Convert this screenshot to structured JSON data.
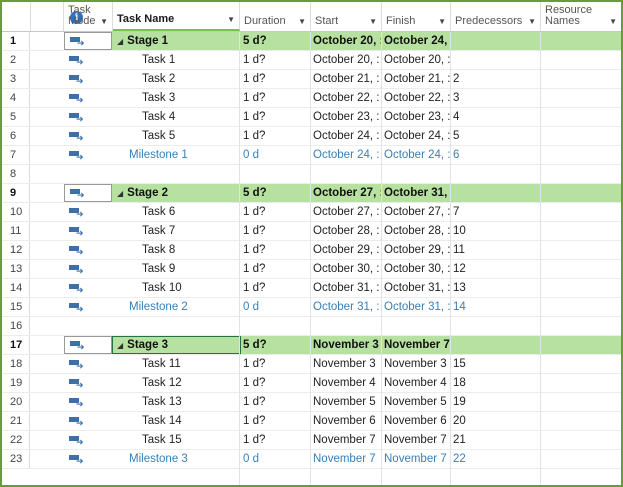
{
  "columns": {
    "mode": "Task\nMode",
    "task_name": "Task Name",
    "duration": "Duration",
    "start": "Start",
    "finish": "Finish",
    "predecessors": "Predecessors",
    "resource_names": "Resource\nNames"
  },
  "rows": [
    {
      "id": "1",
      "type": "summary",
      "name": "Stage 1",
      "duration": "5 d?",
      "start": "October 20, :",
      "finish": "October 24, :",
      "pred": "",
      "note": false
    },
    {
      "id": "2",
      "type": "task",
      "name": "Task 1",
      "duration": "1 d?",
      "start": "October 20, :",
      "finish": "October 20, :",
      "pred": "",
      "note": true
    },
    {
      "id": "3",
      "type": "task",
      "name": "Task 2",
      "duration": "1 d?",
      "start": "October 21, :",
      "finish": "October 21, :",
      "pred": "2",
      "note": true
    },
    {
      "id": "4",
      "type": "task",
      "name": "Task 3",
      "duration": "1 d?",
      "start": "October 22, :",
      "finish": "October 22, :",
      "pred": "3",
      "note": true
    },
    {
      "id": "5",
      "type": "task",
      "name": "Task 4",
      "duration": "1 d?",
      "start": "October 23, :",
      "finish": "October 23, :",
      "pred": "4",
      "note": true
    },
    {
      "id": "6",
      "type": "task",
      "name": "Task 5",
      "duration": "1 d?",
      "start": "October 24, :",
      "finish": "October 24, :",
      "pred": "5",
      "note": false
    },
    {
      "id": "7",
      "type": "milestone",
      "name": "Milestone 1",
      "duration": "0 d",
      "start": "October 24, :",
      "finish": "October 24, :",
      "pred": "6",
      "note": false
    },
    {
      "id": "8",
      "type": "blank"
    },
    {
      "id": "9",
      "type": "summary",
      "name": "Stage 2",
      "duration": "5 d?",
      "start": "October 27, :",
      "finish": "October 31, :",
      "pred": "",
      "note": false
    },
    {
      "id": "10",
      "type": "task",
      "name": "Task 6",
      "duration": "1 d?",
      "start": "October 27, :",
      "finish": "October 27, :",
      "pred": "7",
      "note": false
    },
    {
      "id": "11",
      "type": "task",
      "name": "Task 7",
      "duration": "1 d?",
      "start": "October 28, :",
      "finish": "October 28, :",
      "pred": "10",
      "note": false
    },
    {
      "id": "12",
      "type": "task",
      "name": "Task 8",
      "duration": "1 d?",
      "start": "October 29, :",
      "finish": "October 29, :",
      "pred": "11",
      "note": false
    },
    {
      "id": "13",
      "type": "task",
      "name": "Task 9",
      "duration": "1 d?",
      "start": "October 30, :",
      "finish": "October 30, :",
      "pred": "12",
      "note": false
    },
    {
      "id": "14",
      "type": "task",
      "name": "Task 10",
      "duration": "1 d?",
      "start": "October 31, :",
      "finish": "October 31, :",
      "pred": "13",
      "note": false
    },
    {
      "id": "15",
      "type": "milestone",
      "name": "Milestone 2",
      "duration": "0 d",
      "start": "October 31, :",
      "finish": "October 31, :",
      "pred": "14",
      "note": false
    },
    {
      "id": "16",
      "type": "blank"
    },
    {
      "id": "17",
      "type": "summary",
      "name": "Stage 3",
      "duration": "5 d?",
      "start": "November 3",
      "finish": "November 7",
      "pred": "",
      "note": false,
      "selected": true
    },
    {
      "id": "18",
      "type": "task",
      "name": "Task 11",
      "duration": "1 d?",
      "start": "November 3",
      "finish": "November 3",
      "pred": "15",
      "note": false
    },
    {
      "id": "19",
      "type": "task",
      "name": "Task 12",
      "duration": "1 d?",
      "start": "November 4",
      "finish": "November 4",
      "pred": "18",
      "note": false
    },
    {
      "id": "20",
      "type": "task",
      "name": "Task 13",
      "duration": "1 d?",
      "start": "November 5",
      "finish": "November 5",
      "pred": "19",
      "note": false
    },
    {
      "id": "21",
      "type": "task",
      "name": "Task 14",
      "duration": "1 d?",
      "start": "November 6",
      "finish": "November 6",
      "pred": "20",
      "note": false
    },
    {
      "id": "22",
      "type": "task",
      "name": "Task 15",
      "duration": "1 d?",
      "start": "November 7",
      "finish": "November 7",
      "pred": "21",
      "note": false
    },
    {
      "id": "23",
      "type": "milestone",
      "name": "Milestone 3",
      "duration": "0 d",
      "start": "November 7",
      "finish": "November 7",
      "pred": "22",
      "note": false
    }
  ],
  "colors": {
    "summary_bg": "#b7e1a1",
    "milestone_text": "#3a7fb5",
    "mode_icon": "#3d6fa8",
    "note_icon": "#f0c75a",
    "info_icon": "#2f74c0"
  },
  "icons": {
    "info": "info-icon",
    "mode": "auto-scheduled-mode-icon",
    "note": "note-icon",
    "collapse": "collapse-triangle-icon"
  }
}
